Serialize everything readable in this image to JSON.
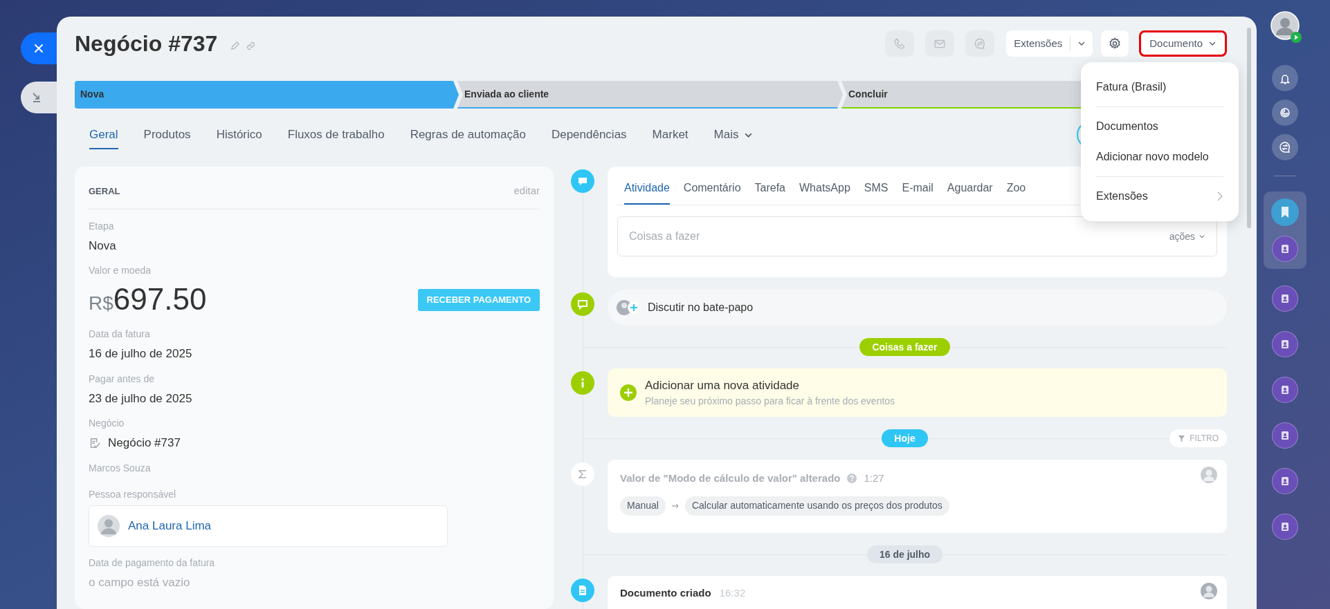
{
  "title": "Negócio #737",
  "header": {
    "extensions": "Extensões",
    "document": "Documento"
  },
  "stages": [
    {
      "label": "Nova",
      "selected": true,
      "color": "#3ba9ee"
    },
    {
      "label": "Enviada ao cliente",
      "selected": false,
      "color": "#3ba9ee"
    },
    {
      "label": "Concluir",
      "selected": false,
      "color": "#7bd500"
    }
  ],
  "tabs": [
    {
      "label": "Geral",
      "selected": true,
      "kind": "tab"
    },
    {
      "label": "Produtos",
      "selected": false,
      "kind": "tab"
    },
    {
      "label": "Histórico",
      "selected": false,
      "kind": "tab"
    },
    {
      "label": "Fluxos de trabalho",
      "selected": false,
      "kind": "tab"
    },
    {
      "label": "Regras de automação",
      "selected": false,
      "kind": "tab"
    },
    {
      "label": "Dependências",
      "selected": false,
      "kind": "tab"
    },
    {
      "label": "Market",
      "selected": false,
      "kind": "tab"
    },
    {
      "label": "Mais",
      "selected": false,
      "kind": "more"
    }
  ],
  "dropdown_menu": {
    "sections": [
      {
        "items": [
          {
            "label": "Fatura (Brasil)",
            "submenu": false
          }
        ]
      },
      {
        "items": [
          {
            "label": "Documentos",
            "submenu": false
          },
          {
            "label": "Adicionar novo modelo",
            "submenu": false
          }
        ]
      },
      {
        "items": [
          {
            "label": "Extensões",
            "submenu": true
          }
        ]
      }
    ]
  },
  "general": {
    "heading": "GERAL",
    "edit": "editar",
    "fields": [
      {
        "kind": "text",
        "label": "Etapa",
        "value": "Nova"
      },
      {
        "kind": "money",
        "label": "Valor e moeda",
        "currency": "R$",
        "amount": "697.50",
        "button": "RECEBER PAGAMENTO"
      },
      {
        "kind": "text",
        "label": "Data da fatura",
        "value": "16 de julho de 2025"
      },
      {
        "kind": "text",
        "label": "Pagar antes de",
        "value": "23 de julho de 2025"
      },
      {
        "kind": "deal",
        "label": "Negócio",
        "value": "Negócio #737"
      },
      {
        "kind": "note",
        "value": "Marcos Souza"
      },
      {
        "kind": "person",
        "label": "Pessoa responsável",
        "value": "Ana Laura Lima"
      },
      {
        "kind": "empty",
        "label": "Data de pagamento da fatura",
        "value": "o campo está vazio"
      }
    ]
  },
  "timeline": [
    {
      "kind": "composer",
      "tabs": [
        {
          "label": "Atividade",
          "selected": true
        },
        {
          "label": "Comentário",
          "selected": false
        },
        {
          "label": "Tarefa",
          "selected": false
        },
        {
          "label": "WhatsApp",
          "selected": false
        },
        {
          "label": "SMS",
          "selected": false
        },
        {
          "label": "E-mail",
          "selected": false
        },
        {
          "label": "Aguardar",
          "selected": false
        },
        {
          "label": "Zoo",
          "selected": false
        }
      ],
      "placeholder": "Coisas a fazer",
      "actions": "ações"
    },
    {
      "kind": "chat",
      "text": "Discutir no bate-papo"
    },
    {
      "kind": "divider",
      "label": "Coisas a fazer",
      "color": "#9dcf00"
    },
    {
      "kind": "todo",
      "title": "Adicionar uma nova atividade",
      "subtitle": "Planeje seu próximo passo para ficar à frente dos eventos"
    },
    {
      "kind": "divider",
      "label": "Hoje",
      "color": "#2fc6f6",
      "filter": "FILTRO"
    },
    {
      "kind": "change",
      "title": "Valor de \"Modo de cálculo de valor\" alterado",
      "time": "1:27",
      "from": "Manual",
      "to": "Calcular automaticamente usando os preços dos produtos"
    },
    {
      "kind": "divider",
      "label": "16 de julho",
      "color": "#dfe5ea"
    },
    {
      "kind": "event",
      "title": "Documento criado",
      "time": "16:32"
    }
  ]
}
